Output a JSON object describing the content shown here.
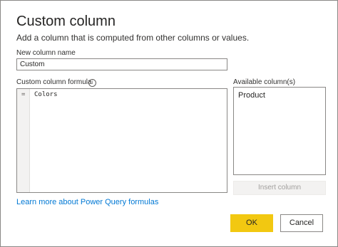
{
  "dialog": {
    "title": "Custom column",
    "subtitle": "Add a column that is computed from other columns or values."
  },
  "name_field": {
    "label": "New column name",
    "value": "Custom"
  },
  "formula": {
    "label": "Custom column formula",
    "info_icon": "info-icon",
    "prefix": "=",
    "value": "Colors"
  },
  "available": {
    "label": "Available column(s)",
    "items": [
      "Product"
    ],
    "insert_label": "Insert column"
  },
  "learn_more": "Learn more about Power Query formulas",
  "buttons": {
    "ok": "OK",
    "cancel": "Cancel"
  },
  "colors": {
    "ok_button": "#f2c811",
    "link": "#0078d4"
  }
}
